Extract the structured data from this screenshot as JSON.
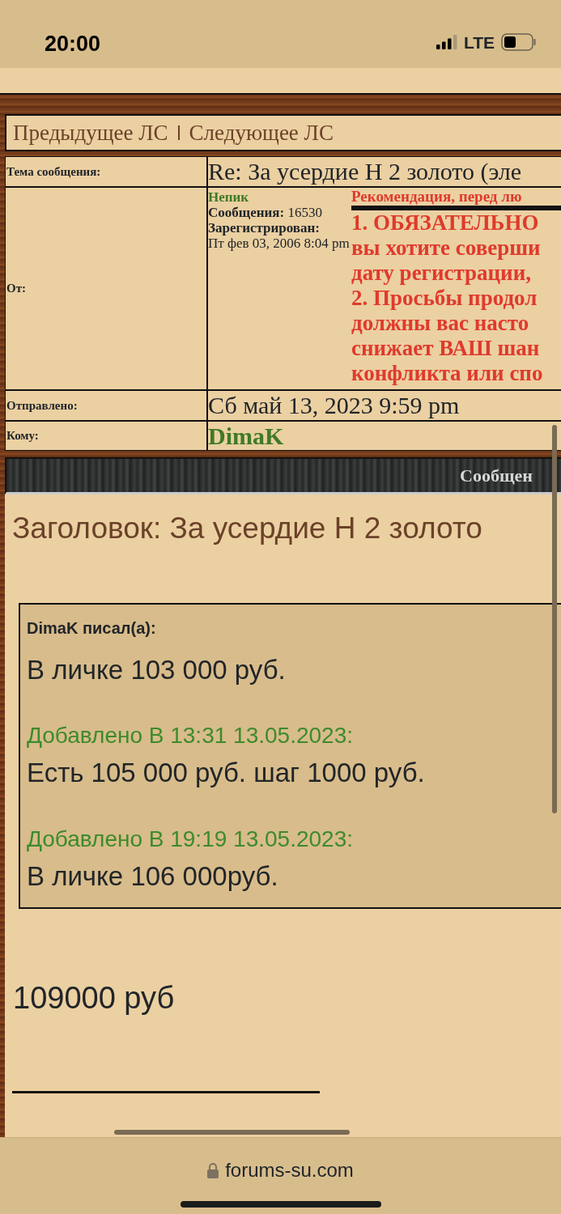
{
  "status_bar": {
    "time": "20:00",
    "network": "LTE"
  },
  "nav": {
    "links": [
      {
        "label": "Предыдущее ЛС"
      },
      {
        "label": "Следующее ЛС"
      }
    ]
  },
  "message_info": {
    "subject_label": "Тема сообщения:",
    "subject": "Re: За усердие Н 2 золото (эле",
    "from_label": "От:",
    "author": {
      "name": "Непик",
      "posts_label": "Сообщения:",
      "posts": "16530",
      "registered_label": "Зарегистрирован:",
      "registered": "Пт фев 03, 2006 8:04 pm"
    },
    "notice": {
      "title": "Рекомендация, перед лю",
      "lines": [
        "1. ОБЯЗАТЕЛЬНО",
        "вы хотите соверши",
        "дату регистрации,",
        "2. Просьбы продол",
        "должны вас насто",
        "снижает ВАШ шан",
        "конфликта или спо"
      ]
    },
    "sent_label": "Отправлено:",
    "sent": "Сб май 13, 2023 9:59 pm",
    "to_label": "Кому:",
    "to": "DimaK"
  },
  "post": {
    "header": "Сообщен",
    "title": "Заголовок: За усердие Н 2 золото",
    "quote": {
      "author": "DimaK писал(а):",
      "entries": [
        {
          "kind": "text",
          "text": "В личке 103 000 руб."
        },
        {
          "kind": "added",
          "text": "Добавлено В 13:31 13.05.2023:"
        },
        {
          "kind": "text",
          "text": "Есть 105 000 руб. шаг 1000 руб."
        },
        {
          "kind": "added",
          "text": "Добавлено В 19:19 13.05.2023:"
        },
        {
          "kind": "text",
          "text": "В личке 106 000руб."
        }
      ]
    },
    "body": "109000 руб"
  },
  "browser_bar": {
    "url": "forums-su.com"
  }
}
